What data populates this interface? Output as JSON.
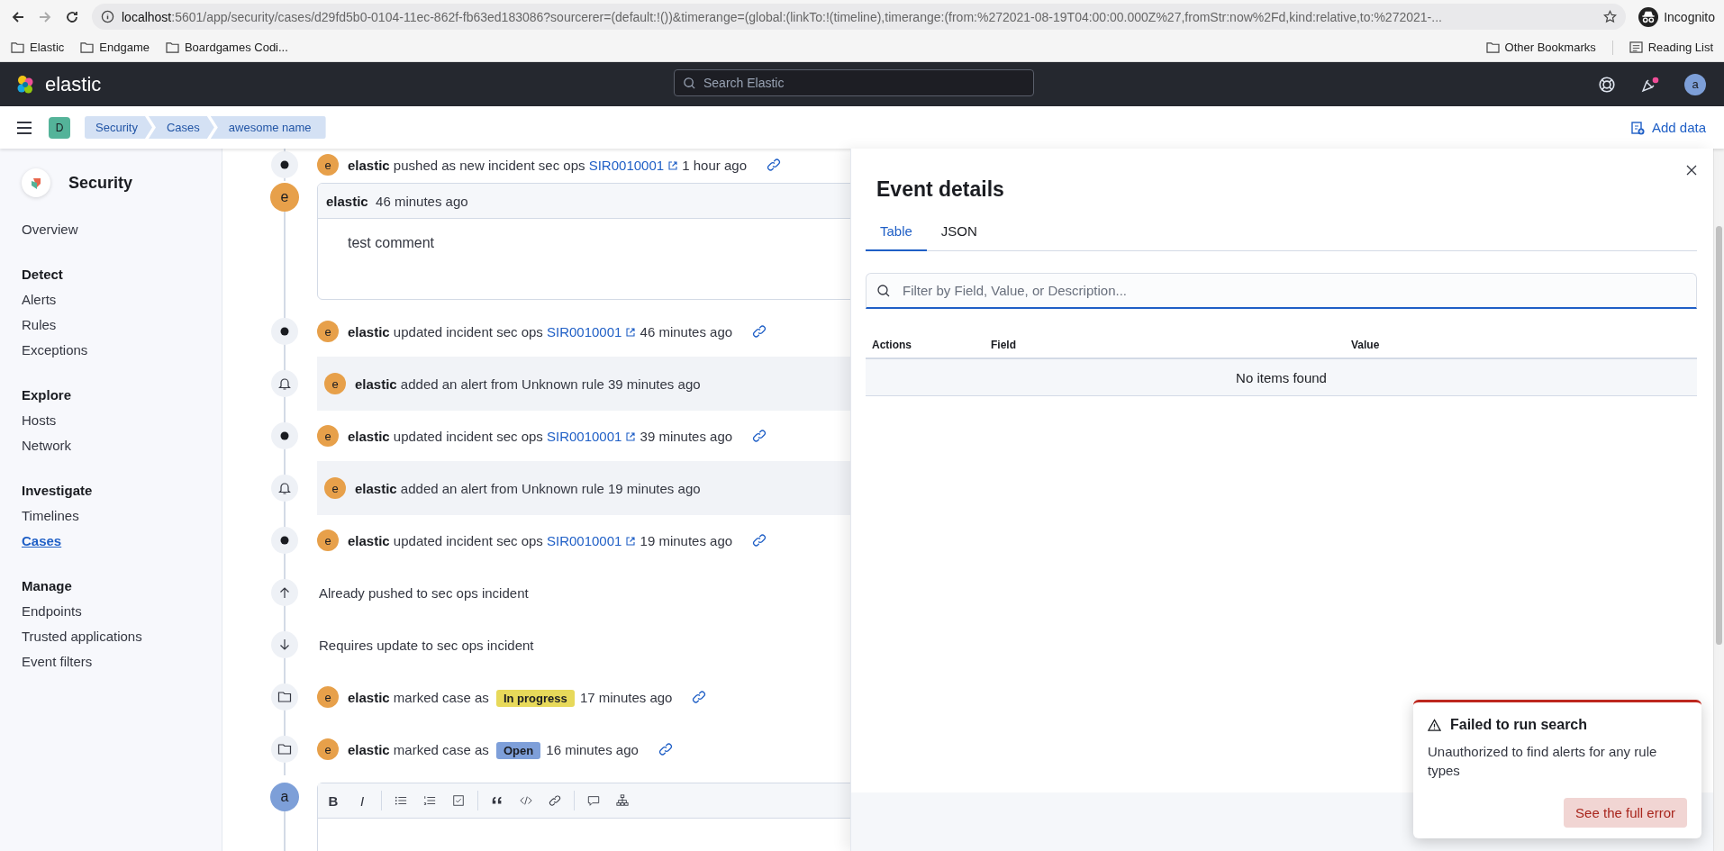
{
  "browser": {
    "url_host": "localhost",
    "url_path": ":5601/app/security/cases/d29fd5b0-0104-11ec-862f-fb63ed183086?sourcerer=(default:!())&timerange=(global:(linkTo:!(timeline),timerange:(from:%272021-08-19T04:00:00.000Z%27,fromStr:now%2Fd,kind:relative,to:%272021-...",
    "profile": "Incognito",
    "bookmarks": [
      "Elastic",
      "Endgame",
      "Boardgames Codi..."
    ],
    "other_bookmarks": "Other Bookmarks",
    "reading_list": "Reading List"
  },
  "header": {
    "brand": "elastic",
    "search_placeholder": "Search Elastic",
    "user_avatar": "a"
  },
  "breadcrumb_bar": {
    "space": "D",
    "crumbs": [
      "Security",
      "Cases",
      "awesome name"
    ],
    "add_data": "Add data"
  },
  "sidebar": {
    "title": "Security",
    "groups": [
      {
        "items": [
          {
            "label": "Overview",
            "selected": false
          }
        ]
      },
      {
        "heading": "Detect",
        "items": [
          {
            "label": "Alerts",
            "selected": false
          },
          {
            "label": "Rules",
            "selected": false
          },
          {
            "label": "Exceptions",
            "selected": false
          }
        ]
      },
      {
        "heading": "Explore",
        "items": [
          {
            "label": "Hosts",
            "selected": false
          },
          {
            "label": "Network",
            "selected": false
          }
        ]
      },
      {
        "heading": "Investigate",
        "items": [
          {
            "label": "Timelines",
            "selected": false
          },
          {
            "label": "Cases",
            "selected": true
          }
        ]
      },
      {
        "heading": "Manage",
        "items": [
          {
            "label": "Endpoints",
            "selected": false
          },
          {
            "label": "Trusted applications",
            "selected": false
          },
          {
            "label": "Event filters",
            "selected": false
          }
        ]
      }
    ]
  },
  "timeline": [
    {
      "kind": "update",
      "avatar": "e",
      "user": "elastic",
      "text": "pushed as new incident sec ops",
      "link": "SIR0010001",
      "time": "1 hour ago"
    },
    {
      "kind": "comment",
      "avatar": "e",
      "user": "elastic",
      "time": "46 minutes ago",
      "body": "test comment"
    },
    {
      "kind": "update",
      "avatar": "e",
      "user": "elastic",
      "text": "updated incident sec ops",
      "link": "SIR0010001",
      "time": "46 minutes ago"
    },
    {
      "kind": "alert",
      "avatar": "e",
      "user": "elastic",
      "text": "added an alert from Unknown rule 39 minutes ago"
    },
    {
      "kind": "update",
      "avatar": "e",
      "user": "elastic",
      "text": "updated incident sec ops",
      "link": "SIR0010001",
      "time": "39 minutes ago"
    },
    {
      "kind": "alert",
      "avatar": "e",
      "user": "elastic",
      "text": "added an alert from Unknown rule 19 minutes ago"
    },
    {
      "kind": "update",
      "avatar": "e",
      "user": "elastic",
      "text": "updated incident sec ops",
      "link": "SIR0010001",
      "time": "19 minutes ago"
    },
    {
      "kind": "pushed",
      "text": "Already pushed to sec ops incident"
    },
    {
      "kind": "outdated",
      "text": "Requires update to sec ops incident"
    },
    {
      "kind": "status",
      "avatar": "e",
      "user": "elastic",
      "text": "marked case as",
      "badge": "In progress",
      "color": "#e7d95a",
      "time": "17 minutes ago"
    },
    {
      "kind": "status",
      "avatar": "e",
      "user": "elastic",
      "text": "marked case as",
      "badge": "Open",
      "color": "#7e9fd9",
      "time": "16 minutes ago"
    },
    {
      "kind": "editor",
      "avatar": "a",
      "bold_label": "B",
      "italic_label": "I"
    }
  ],
  "flyout": {
    "title": "Event details",
    "tabs": [
      {
        "label": "Table",
        "selected": true
      },
      {
        "label": "JSON",
        "selected": false
      }
    ],
    "filter_placeholder": "Filter by Field, Value, or Description...",
    "columns": [
      "Actions",
      "Field",
      "Value"
    ],
    "empty": "No items found"
  },
  "toast": {
    "title": "Failed to run search",
    "body": "Unauthorized to find alerts for any rule types",
    "button": "See the full error"
  }
}
